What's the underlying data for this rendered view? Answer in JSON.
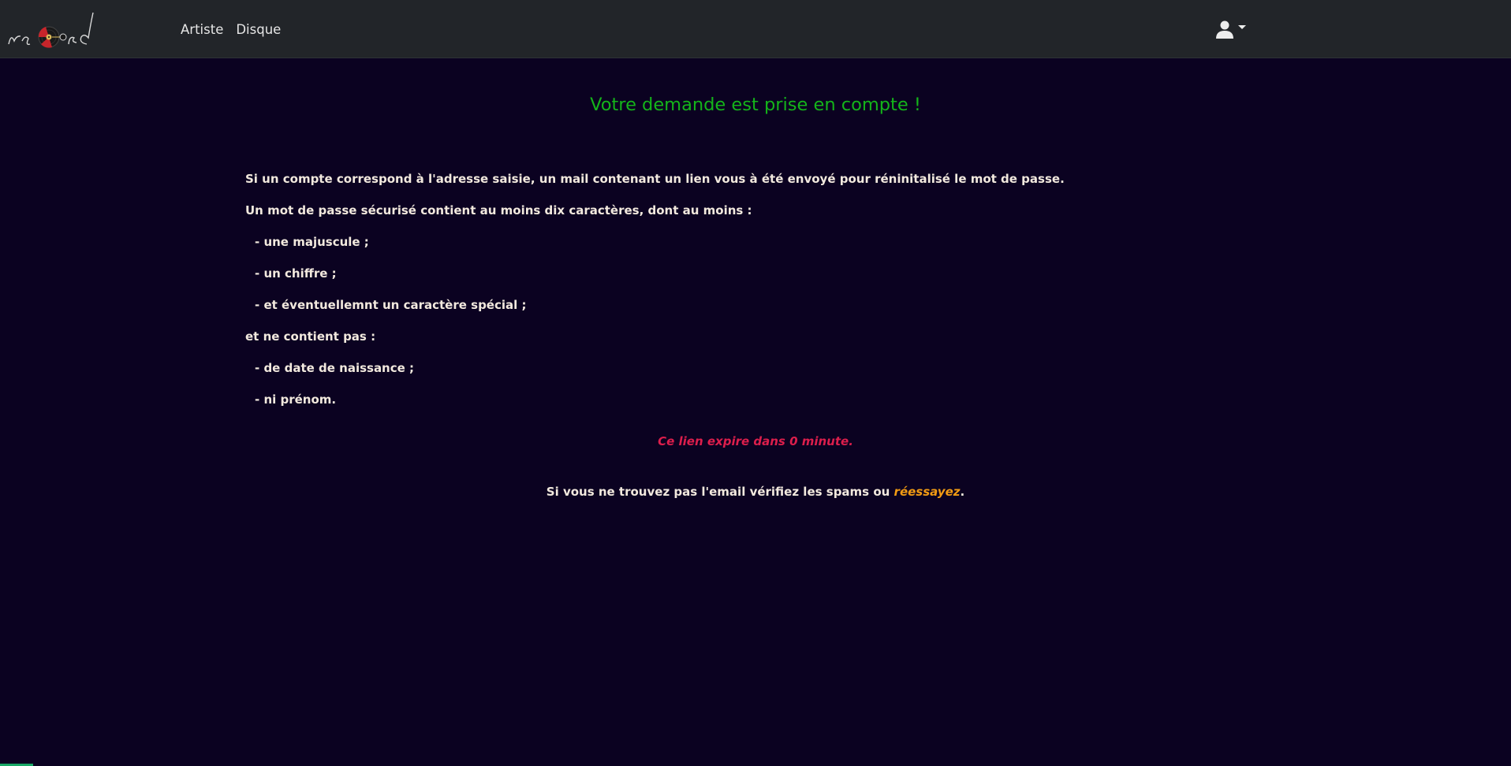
{
  "navbar": {
    "logo_text": "record",
    "links": [
      "Artiste",
      "Disque"
    ],
    "user_icon": "user-icon"
  },
  "main": {
    "title": "Votre demande est prise en compte !",
    "paragraphs": [
      "Si un compte correspond à l'adresse saisie, un mail contenant un lien vous à été envoyé pour réninitalisé le mot de passe.",
      "Un mot de passe sécurisé contient au moins dix caractères, dont au moins :",
      "- une majuscule ;",
      "- un chiffre ;",
      "- et éventuellemnt un caractère spécial ;",
      "et ne contient pas :",
      "- de date de naissance ;",
      "- ni prénom."
    ],
    "expire_text": "Ce lien expire dans 0 minute.",
    "retry": {
      "text": "Si vous ne trouvez pas l'email vérifiez les spams ou ",
      "link": "réessayez",
      "suffix": "."
    }
  },
  "colors": {
    "navbar_bg": "#222529",
    "page_bg": "#0b0221",
    "title": "#14b41a",
    "body_text": "#f2e9de",
    "expire": "#dc1e4c",
    "link": "#f29b13"
  }
}
